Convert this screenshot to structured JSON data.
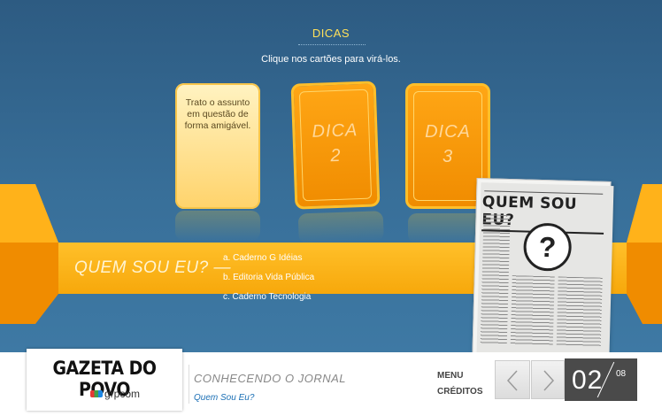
{
  "header": {
    "title": "DICAS",
    "instruction": "Clique nos cartões para virá-los."
  },
  "cards": [
    {
      "state": "front",
      "text": "Trato o assunto em questão de forma amigável."
    },
    {
      "state": "back",
      "label_line1": "DICA",
      "label_line2": "2"
    },
    {
      "state": "back",
      "label_line1": "DICA",
      "label_line2": "3"
    }
  ],
  "band": {
    "prompt": "QUEM SOU EU? —",
    "options": [
      "a. Caderno G Idéias",
      "b. Editoria Vida Pública",
      "c. Caderno Tecnologia"
    ]
  },
  "newspaper": {
    "headline": "QUEM SOU EU?",
    "symbol": "?"
  },
  "footer": {
    "logo": "GAZETA DO POVO",
    "sublogo": "grpcom",
    "section_title": "CONHECENDO O JORNAL",
    "section_subtitle": "Quem Sou Eu?",
    "menu_label": "MENU",
    "credits_label": "CRÉDITOS",
    "page_current": "02",
    "page_total": "08"
  },
  "colors": {
    "background": "#2f5f86",
    "accent_orange": "#f7a80b",
    "title_yellow": "#ffe15a",
    "pager_bg": "#4a4a4a"
  }
}
